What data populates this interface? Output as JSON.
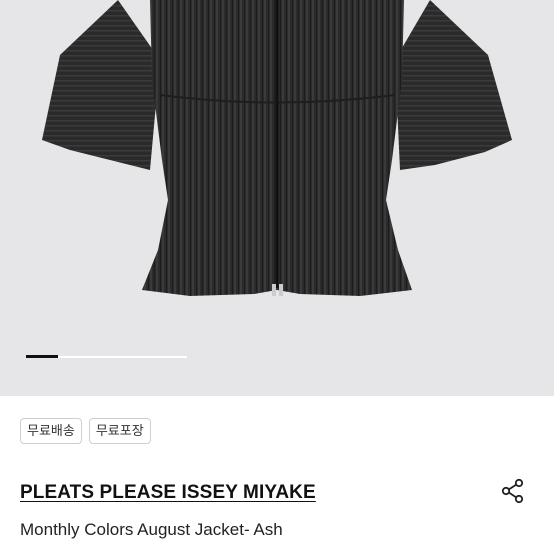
{
  "product": {
    "image_alt": "Black pleated jacket with wide sleeves and front zipper",
    "carousel": {
      "current": 1,
      "progress": 0.2
    },
    "tags": [
      "무료배송",
      "무료포장"
    ],
    "brand": "PLEATS PLEASE ISSEY MIYAKE",
    "name": "Monthly Colors August Jacket- Ash"
  },
  "colors": {
    "hero_bg": "#e6e6e8",
    "garment": "#2a2a2a",
    "text": "#111111"
  },
  "icons": {
    "share": "share-icon"
  }
}
